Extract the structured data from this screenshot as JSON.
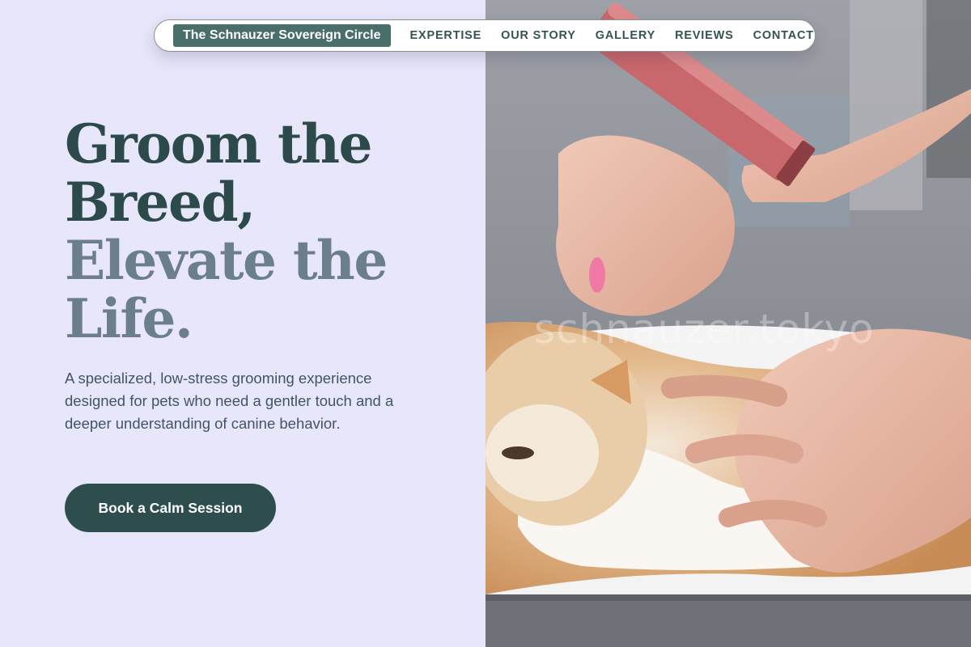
{
  "nav": {
    "brand": "The Schnauzer Sovereign Circle",
    "links": [
      "EXPERTISE",
      "OUR STORY",
      "GALLERY",
      "REVIEWS",
      "CONTACT"
    ]
  },
  "hero": {
    "title_line1": "Groom the",
    "title_line2": "Breed,",
    "title_line3": "Elevate the",
    "title_line4": "Life.",
    "description": "A specialized, low-stress grooming experience designed for pets who need a gentler touch and a deeper understanding of canine behavior.",
    "cta_label": "Book a Calm Session"
  },
  "photo": {
    "watermark": "schnauzer.tokyo",
    "subject": "groomer trimming a cream-and-white long-haired cat with clippers"
  },
  "colors": {
    "panel_bg": "#e8e6fa",
    "brand_bg": "#4a6e6a",
    "title_dark": "#2c4a4a",
    "title_muted": "#6b7e8c",
    "cta_bg": "#2e4d4d"
  }
}
